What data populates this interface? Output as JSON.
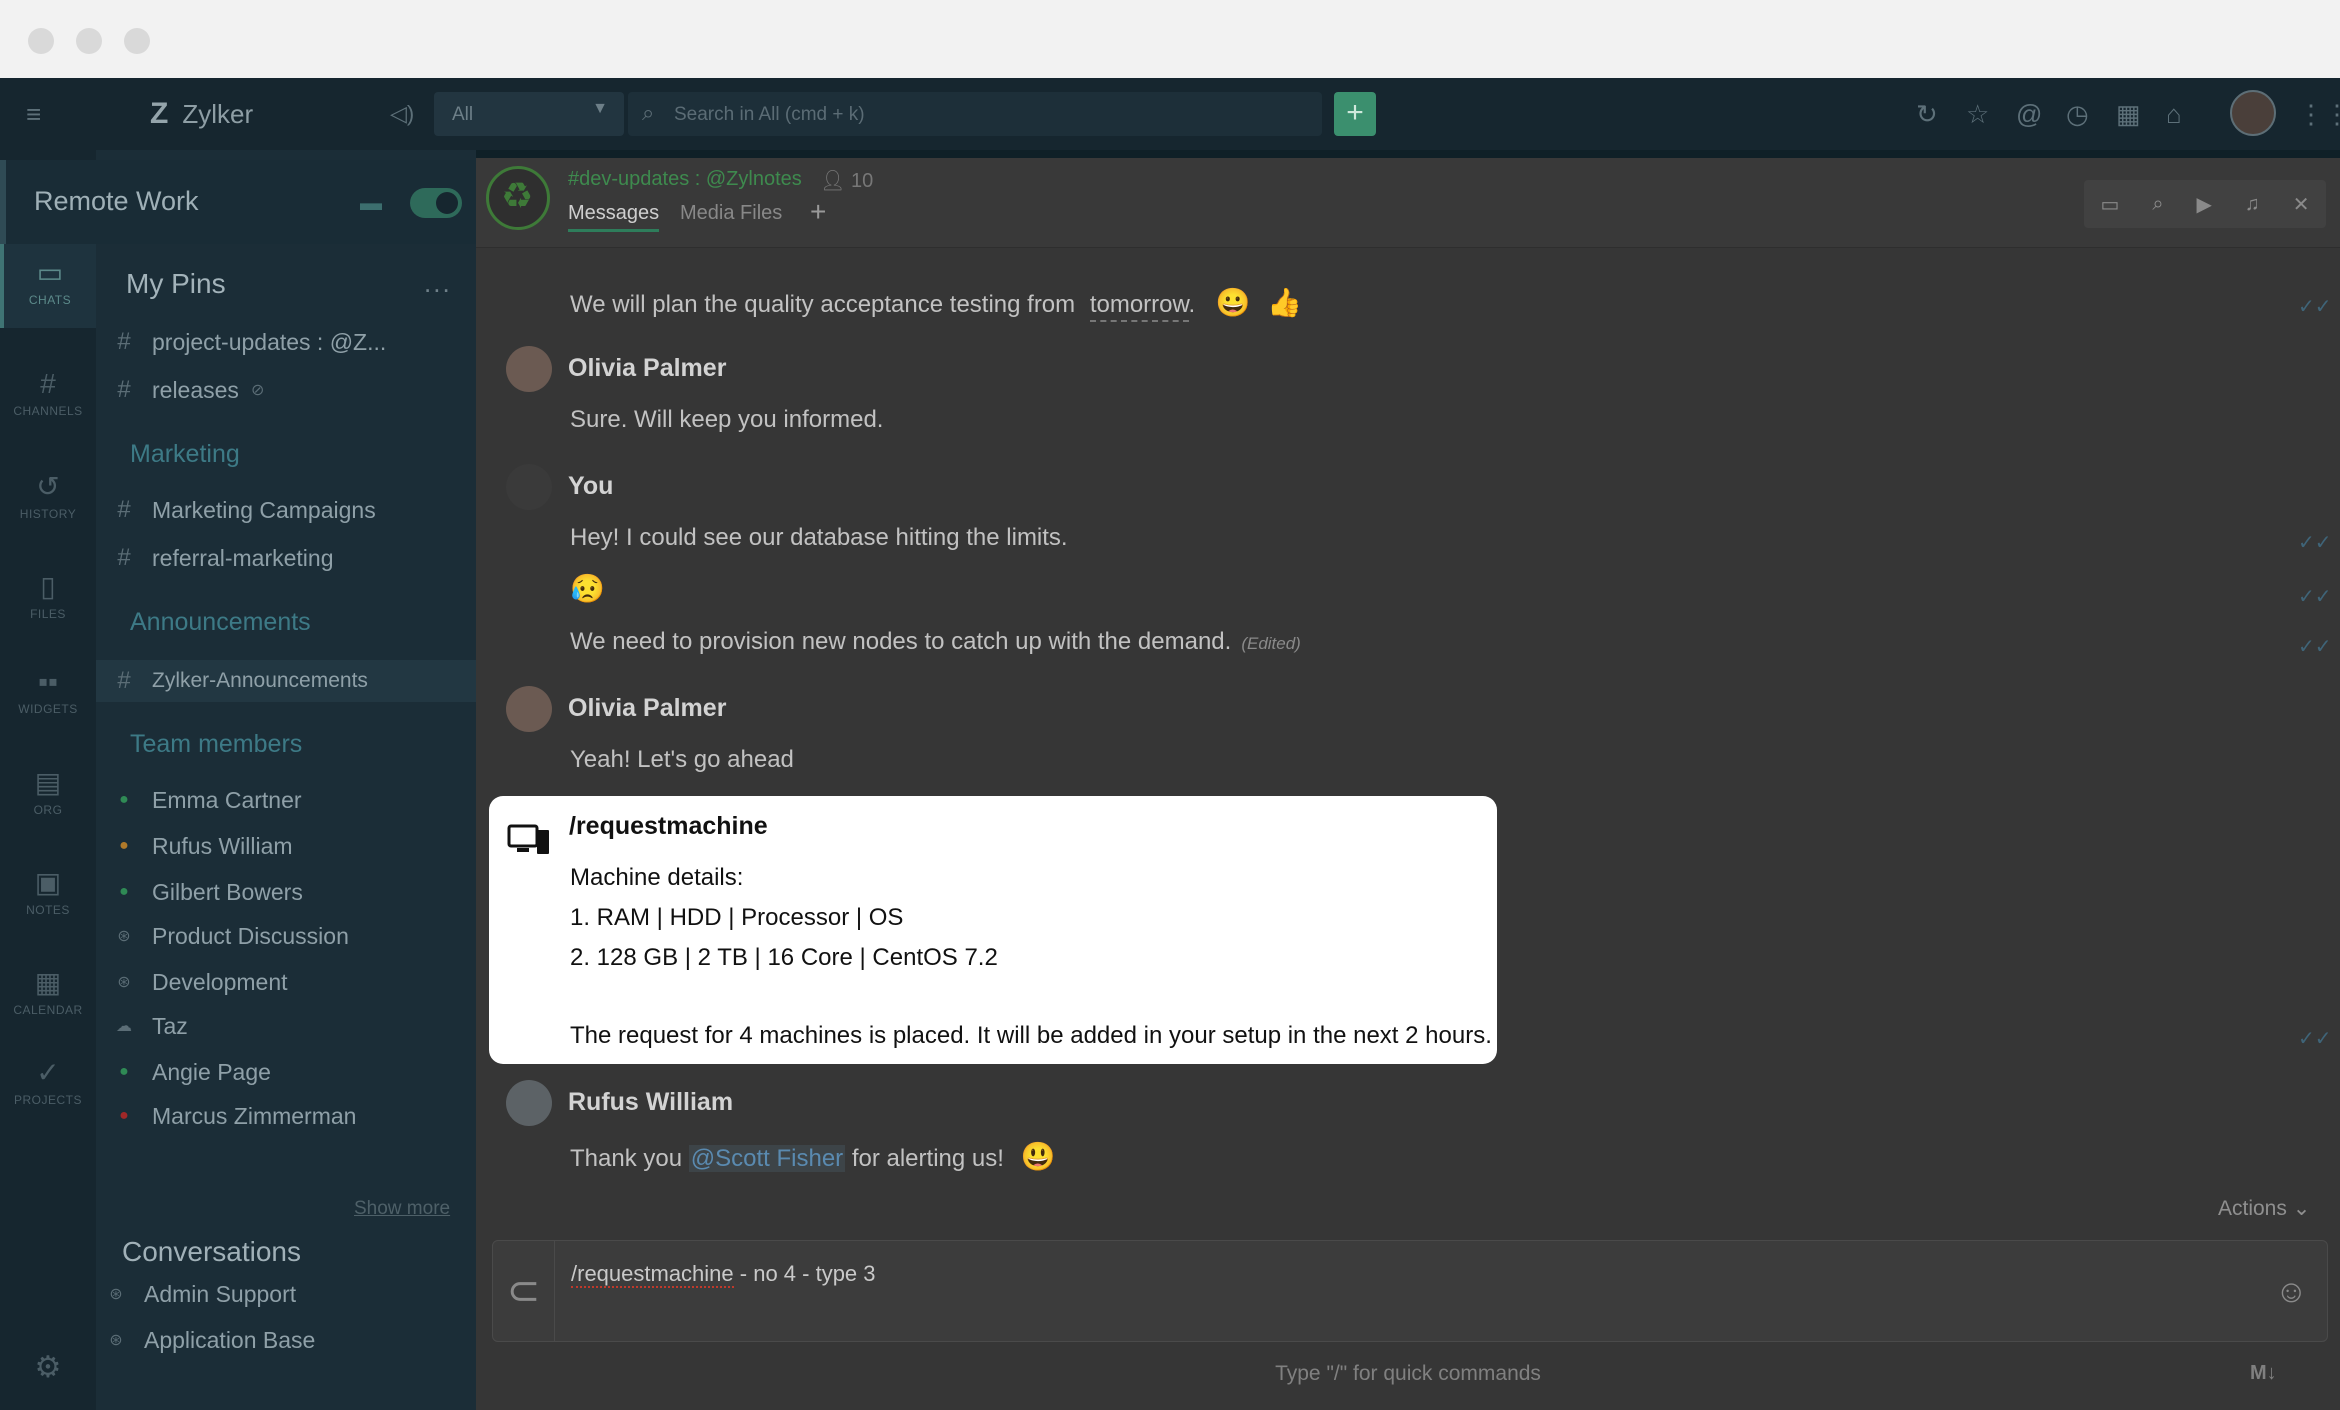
{
  "app": {
    "brand": "Zylker",
    "search_scope": "All",
    "search_placeholder": "Search in All (cmd + k)"
  },
  "rail": [
    {
      "label": "CHATS",
      "icon": "chat-icon"
    },
    {
      "label": "CHANNELS",
      "icon": "hash-icon"
    },
    {
      "label": "HISTORY",
      "icon": "history-icon"
    },
    {
      "label": "FILES",
      "icon": "file-icon"
    },
    {
      "label": "WIDGETS",
      "icon": "widgets-icon"
    },
    {
      "label": "ORG",
      "icon": "org-icon"
    },
    {
      "label": "NOTES",
      "icon": "notes-icon"
    },
    {
      "label": "CALENDAR",
      "icon": "calendar-icon"
    },
    {
      "label": "PROJECTS",
      "icon": "projects-icon"
    }
  ],
  "sidebar": {
    "workspace": "Remote Work",
    "pins_title": "My Pins",
    "pins_more": "...",
    "pins": [
      "project-updates : @Z...",
      "releases"
    ],
    "marketing_title": "Marketing",
    "marketing": [
      "Marketing Campaigns",
      "referral-marketing"
    ],
    "announcements_title": "Announcements",
    "announcements": [
      "Zylker-Announcements"
    ],
    "team_title": "Team members",
    "team": [
      {
        "name": "Emma  Cartner",
        "status_color": "#2f8a55"
      },
      {
        "name": "Rufus William",
        "status_color": "#b07a2a"
      },
      {
        "name": "Gilbert Bowers",
        "status_color": "#2f8a55"
      },
      {
        "name": "Product Discussion",
        "status_color": "#5b6d76"
      },
      {
        "name": "Development",
        "status_color": "#5b6d76"
      },
      {
        "name": "Taz",
        "status_color": "#5b6d76"
      },
      {
        "name": "Angie Page",
        "status_color": "#2f8a55"
      },
      {
        "name": "Marcus Zimmerman",
        "status_color": "#a02828"
      }
    ],
    "show_more": "Show more",
    "conversations_title": "Conversations",
    "conversations": [
      "Admin Support",
      "Application Base"
    ]
  },
  "chat": {
    "channel_name": "#dev-updates : @Zylnotes",
    "member_count": "10",
    "tabs": [
      "Messages",
      "Media Files"
    ],
    "tab_add": "+",
    "messages": {
      "m0_text": "We will plan the quality acceptance testing from",
      "m0_word": "tomorrow",
      "m0_end": ".",
      "olivia": "Olivia Palmer",
      "m1_text": "Sure. Will keep you informed.",
      "you": "You",
      "m2_text": "Hey! I could see our database hitting the limits.",
      "m3_emoji": "😥",
      "m4_text": "We need to provision new nodes to catch up with the demand.",
      "edited": "(Edited)",
      "m5_text": "Yeah! Let's go ahead",
      "rufus": "Rufus William",
      "m7_pre": "Thank you",
      "m7_mention": "@Scott Fisher",
      "m7_post": "for alerting us!"
    },
    "bot_card": {
      "title": "/requestmachine",
      "line1": "Machine details:",
      "line2": "1. RAM | HDD | Processor | OS",
      "line3": "2. 128 GB | 2 TB | 16 Core | CentOS 7.2",
      "line4": "The request for 4 machines is placed. It will be added in your setup in the next 2 hours."
    },
    "actions_label": "Actions",
    "composer_cmd": "/requestmachine",
    "composer_rest": " - no 4 - type 3",
    "hint": "Type \"/\" for quick commands",
    "md_label": "M↓"
  }
}
